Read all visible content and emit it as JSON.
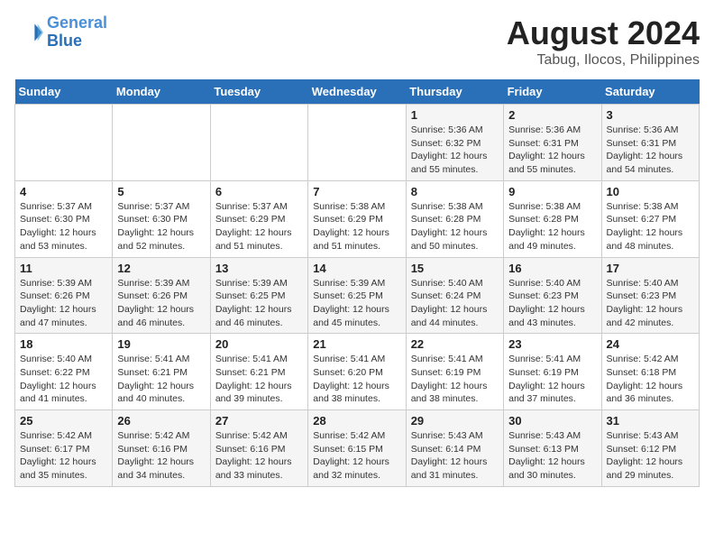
{
  "logo": {
    "line1": "General",
    "line2": "Blue"
  },
  "title": "August 2024",
  "subtitle": "Tabug, Ilocos, Philippines",
  "weekdays": [
    "Sunday",
    "Monday",
    "Tuesday",
    "Wednesday",
    "Thursday",
    "Friday",
    "Saturday"
  ],
  "weeks": [
    [
      {
        "day": "",
        "text": ""
      },
      {
        "day": "",
        "text": ""
      },
      {
        "day": "",
        "text": ""
      },
      {
        "day": "",
        "text": ""
      },
      {
        "day": "1",
        "text": "Sunrise: 5:36 AM\nSunset: 6:32 PM\nDaylight: 12 hours\nand 55 minutes."
      },
      {
        "day": "2",
        "text": "Sunrise: 5:36 AM\nSunset: 6:31 PM\nDaylight: 12 hours\nand 55 minutes."
      },
      {
        "day": "3",
        "text": "Sunrise: 5:36 AM\nSunset: 6:31 PM\nDaylight: 12 hours\nand 54 minutes."
      }
    ],
    [
      {
        "day": "4",
        "text": "Sunrise: 5:37 AM\nSunset: 6:30 PM\nDaylight: 12 hours\nand 53 minutes."
      },
      {
        "day": "5",
        "text": "Sunrise: 5:37 AM\nSunset: 6:30 PM\nDaylight: 12 hours\nand 52 minutes."
      },
      {
        "day": "6",
        "text": "Sunrise: 5:37 AM\nSunset: 6:29 PM\nDaylight: 12 hours\nand 51 minutes."
      },
      {
        "day": "7",
        "text": "Sunrise: 5:38 AM\nSunset: 6:29 PM\nDaylight: 12 hours\nand 51 minutes."
      },
      {
        "day": "8",
        "text": "Sunrise: 5:38 AM\nSunset: 6:28 PM\nDaylight: 12 hours\nand 50 minutes."
      },
      {
        "day": "9",
        "text": "Sunrise: 5:38 AM\nSunset: 6:28 PM\nDaylight: 12 hours\nand 49 minutes."
      },
      {
        "day": "10",
        "text": "Sunrise: 5:38 AM\nSunset: 6:27 PM\nDaylight: 12 hours\nand 48 minutes."
      }
    ],
    [
      {
        "day": "11",
        "text": "Sunrise: 5:39 AM\nSunset: 6:26 PM\nDaylight: 12 hours\nand 47 minutes."
      },
      {
        "day": "12",
        "text": "Sunrise: 5:39 AM\nSunset: 6:26 PM\nDaylight: 12 hours\nand 46 minutes."
      },
      {
        "day": "13",
        "text": "Sunrise: 5:39 AM\nSunset: 6:25 PM\nDaylight: 12 hours\nand 46 minutes."
      },
      {
        "day": "14",
        "text": "Sunrise: 5:39 AM\nSunset: 6:25 PM\nDaylight: 12 hours\nand 45 minutes."
      },
      {
        "day": "15",
        "text": "Sunrise: 5:40 AM\nSunset: 6:24 PM\nDaylight: 12 hours\nand 44 minutes."
      },
      {
        "day": "16",
        "text": "Sunrise: 5:40 AM\nSunset: 6:23 PM\nDaylight: 12 hours\nand 43 minutes."
      },
      {
        "day": "17",
        "text": "Sunrise: 5:40 AM\nSunset: 6:23 PM\nDaylight: 12 hours\nand 42 minutes."
      }
    ],
    [
      {
        "day": "18",
        "text": "Sunrise: 5:40 AM\nSunset: 6:22 PM\nDaylight: 12 hours\nand 41 minutes."
      },
      {
        "day": "19",
        "text": "Sunrise: 5:41 AM\nSunset: 6:21 PM\nDaylight: 12 hours\nand 40 minutes."
      },
      {
        "day": "20",
        "text": "Sunrise: 5:41 AM\nSunset: 6:21 PM\nDaylight: 12 hours\nand 39 minutes."
      },
      {
        "day": "21",
        "text": "Sunrise: 5:41 AM\nSunset: 6:20 PM\nDaylight: 12 hours\nand 38 minutes."
      },
      {
        "day": "22",
        "text": "Sunrise: 5:41 AM\nSunset: 6:19 PM\nDaylight: 12 hours\nand 38 minutes."
      },
      {
        "day": "23",
        "text": "Sunrise: 5:41 AM\nSunset: 6:19 PM\nDaylight: 12 hours\nand 37 minutes."
      },
      {
        "day": "24",
        "text": "Sunrise: 5:42 AM\nSunset: 6:18 PM\nDaylight: 12 hours\nand 36 minutes."
      }
    ],
    [
      {
        "day": "25",
        "text": "Sunrise: 5:42 AM\nSunset: 6:17 PM\nDaylight: 12 hours\nand 35 minutes."
      },
      {
        "day": "26",
        "text": "Sunrise: 5:42 AM\nSunset: 6:16 PM\nDaylight: 12 hours\nand 34 minutes."
      },
      {
        "day": "27",
        "text": "Sunrise: 5:42 AM\nSunset: 6:16 PM\nDaylight: 12 hours\nand 33 minutes."
      },
      {
        "day": "28",
        "text": "Sunrise: 5:42 AM\nSunset: 6:15 PM\nDaylight: 12 hours\nand 32 minutes."
      },
      {
        "day": "29",
        "text": "Sunrise: 5:43 AM\nSunset: 6:14 PM\nDaylight: 12 hours\nand 31 minutes."
      },
      {
        "day": "30",
        "text": "Sunrise: 5:43 AM\nSunset: 6:13 PM\nDaylight: 12 hours\nand 30 minutes."
      },
      {
        "day": "31",
        "text": "Sunrise: 5:43 AM\nSunset: 6:12 PM\nDaylight: 12 hours\nand 29 minutes."
      }
    ]
  ]
}
